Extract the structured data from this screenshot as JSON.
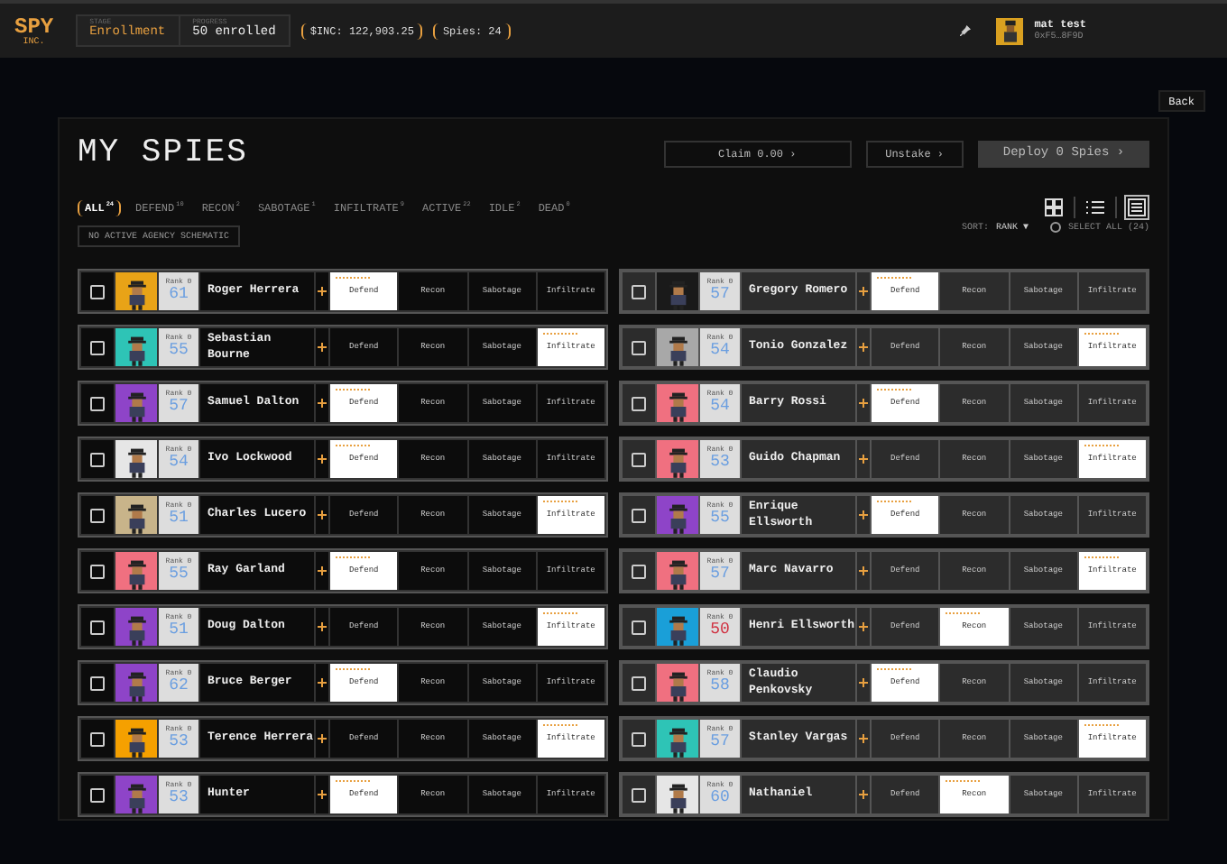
{
  "topbar": {
    "logo": "SPY",
    "logo_sub": "INC.",
    "stage_label": "STAGE",
    "stage": "Enrollment",
    "progress_label": "PROGRESS",
    "progress": "50 enrolled",
    "balance": "$INC: 122,903.25",
    "spies": "Spies: 24",
    "user_name": "mat test",
    "user_address": "0xF5…8F9D"
  },
  "back": "Back",
  "title": "MY SPIES",
  "actions": [
    {
      "label": "Claim 0.00 ›",
      "kind": "outline"
    },
    {
      "label": "Unstake ›",
      "kind": "outline"
    },
    {
      "label": "Deploy 0 Spies ›",
      "kind": "filled"
    }
  ],
  "filters": [
    {
      "label": "ALL",
      "count": "24",
      "selected": true
    },
    {
      "label": "DEFEND",
      "count": "10",
      "selected": false
    },
    {
      "label": "RECON",
      "count": "2",
      "selected": false
    },
    {
      "label": "SABOTAGE",
      "count": "1",
      "selected": false
    },
    {
      "label": "INFILTRATE",
      "count": "9",
      "selected": false
    },
    {
      "label": "ACTIVE",
      "count": "22",
      "selected": false
    },
    {
      "label": "IDLE",
      "count": "2",
      "selected": false
    },
    {
      "label": "DEAD",
      "count": "0",
      "selected": false
    }
  ],
  "views": [
    {
      "kind": "grid",
      "selected": false
    },
    {
      "kind": "list",
      "selected": false
    },
    {
      "kind": "table",
      "selected": true
    }
  ],
  "schematic": "NO ACTIVE AGENCY SCHEMATIC",
  "sort_label": "SORT:",
  "sort_value": "RANK ▼",
  "select_all": "SELECT ALL (24)",
  "select_all_checked": false,
  "columns": [
    {
      "kind": "dark",
      "spies": [
        {
          "name": "Roger Herrera",
          "rank_label": "Rank 0",
          "rank": "61",
          "warning": false,
          "color": "#e8a317",
          "checked": false,
          "missions": [
            {
              "label": "Defend",
              "selected": true
            },
            {
              "label": "Recon",
              "selected": false
            },
            {
              "label": "Sabotage",
              "selected": false
            },
            {
              "label": "Infiltrate",
              "selected": false
            }
          ]
        },
        {
          "name": "Sebastian Bourne",
          "rank_label": "Rank 0",
          "rank": "55",
          "warning": false,
          "color": "#2ec4b6",
          "checked": false,
          "missions": [
            {
              "label": "Defend",
              "selected": false
            },
            {
              "label": "Recon",
              "selected": false
            },
            {
              "label": "Sabotage",
              "selected": false
            },
            {
              "label": "Infiltrate",
              "selected": true
            }
          ]
        },
        {
          "name": "Samuel Dalton",
          "rank_label": "Rank 0",
          "rank": "57",
          "warning": false,
          "color": "#8e44c8",
          "checked": false,
          "missions": [
            {
              "label": "Defend",
              "selected": true
            },
            {
              "label": "Recon",
              "selected": false
            },
            {
              "label": "Sabotage",
              "selected": false
            },
            {
              "label": "Infiltrate",
              "selected": false
            }
          ]
        },
        {
          "name": "Ivo Lockwood",
          "rank_label": "Rank 0",
          "rank": "54",
          "warning": false,
          "color": "#e6e6e6",
          "checked": false,
          "missions": [
            {
              "label": "Defend",
              "selected": true
            },
            {
              "label": "Recon",
              "selected": false
            },
            {
              "label": "Sabotage",
              "selected": false
            },
            {
              "label": "Infiltrate",
              "selected": false
            }
          ]
        },
        {
          "name": "Charles Lucero",
          "rank_label": "Rank 0",
          "rank": "51",
          "warning": false,
          "color": "#c8b48a",
          "checked": false,
          "missions": [
            {
              "label": "Defend",
              "selected": false
            },
            {
              "label": "Recon",
              "selected": false
            },
            {
              "label": "Sabotage",
              "selected": false
            },
            {
              "label": "Infiltrate",
              "selected": true
            }
          ]
        },
        {
          "name": "Ray Garland",
          "rank_label": "Rank 0",
          "rank": "55",
          "warning": false,
          "color": "#f07080",
          "checked": false,
          "missions": [
            {
              "label": "Defend",
              "selected": true
            },
            {
              "label": "Recon",
              "selected": false
            },
            {
              "label": "Sabotage",
              "selected": false
            },
            {
              "label": "Infiltrate",
              "selected": false
            }
          ]
        },
        {
          "name": "Doug Dalton",
          "rank_label": "Rank 0",
          "rank": "51",
          "warning": false,
          "color": "#8e44c8",
          "checked": false,
          "missions": [
            {
              "label": "Defend",
              "selected": false
            },
            {
              "label": "Recon",
              "selected": false
            },
            {
              "label": "Sabotage",
              "selected": false
            },
            {
              "label": "Infiltrate",
              "selected": true
            }
          ]
        },
        {
          "name": "Bruce Berger",
          "rank_label": "Rank 0",
          "rank": "62",
          "warning": false,
          "color": "#8e44c8",
          "checked": false,
          "missions": [
            {
              "label": "Defend",
              "selected": true
            },
            {
              "label": "Recon",
              "selected": false
            },
            {
              "label": "Sabotage",
              "selected": false
            },
            {
              "label": "Infiltrate",
              "selected": false
            }
          ]
        },
        {
          "name": "Terence Herrera",
          "rank_label": "Rank 0",
          "rank": "53",
          "warning": false,
          "color": "#f5a000",
          "checked": false,
          "missions": [
            {
              "label": "Defend",
              "selected": false
            },
            {
              "label": "Recon",
              "selected": false
            },
            {
              "label": "Sabotage",
              "selected": false
            },
            {
              "label": "Infiltrate",
              "selected": true
            }
          ]
        },
        {
          "name": "Hunter",
          "rank_label": "Rank 0",
          "rank": "53",
          "warning": false,
          "color": "#8e44c8",
          "checked": false,
          "missions": [
            {
              "label": "Defend",
              "selected": true
            },
            {
              "label": "Recon",
              "selected": false
            },
            {
              "label": "Sabotage",
              "selected": false
            },
            {
              "label": "Infiltrate",
              "selected": false
            }
          ]
        }
      ]
    },
    {
      "kind": "grey",
      "spies": [
        {
          "name": "Gregory Romero",
          "rank_label": "Rank 0",
          "rank": "57",
          "warning": false,
          "color": "#1a1a1a",
          "checked": false,
          "missions": [
            {
              "label": "Defend",
              "selected": true
            },
            {
              "label": "Recon",
              "selected": false
            },
            {
              "label": "Sabotage",
              "selected": false
            },
            {
              "label": "Infiltrate",
              "selected": false
            }
          ]
        },
        {
          "name": "Tonio Gonzalez",
          "rank_label": "Rank 0",
          "rank": "54",
          "warning": false,
          "color": "#a8a8a8",
          "checked": false,
          "missions": [
            {
              "label": "Defend",
              "selected": false
            },
            {
              "label": "Recon",
              "selected": false
            },
            {
              "label": "Sabotage",
              "selected": false
            },
            {
              "label": "Infiltrate",
              "selected": true
            }
          ]
        },
        {
          "name": "Barry Rossi",
          "rank_label": "Rank 0",
          "rank": "54",
          "warning": false,
          "color": "#f07080",
          "checked": false,
          "missions": [
            {
              "label": "Defend",
              "selected": true
            },
            {
              "label": "Recon",
              "selected": false
            },
            {
              "label": "Sabotage",
              "selected": false
            },
            {
              "label": "Infiltrate",
              "selected": false
            }
          ]
        },
        {
          "name": "Guido Chapman",
          "rank_label": "Rank 0",
          "rank": "53",
          "warning": false,
          "color": "#f07080",
          "checked": false,
          "missions": [
            {
              "label": "Defend",
              "selected": false
            },
            {
              "label": "Recon",
              "selected": false
            },
            {
              "label": "Sabotage",
              "selected": false
            },
            {
              "label": "Infiltrate",
              "selected": true
            }
          ]
        },
        {
          "name": "Enrique Ellsworth",
          "rank_label": "Rank 0",
          "rank": "55",
          "warning": false,
          "color": "#8e44c8",
          "checked": false,
          "missions": [
            {
              "label": "Defend",
              "selected": true
            },
            {
              "label": "Recon",
              "selected": false
            },
            {
              "label": "Sabotage",
              "selected": false
            },
            {
              "label": "Infiltrate",
              "selected": false
            }
          ]
        },
        {
          "name": "Marc Navarro",
          "rank_label": "Rank 0",
          "rank": "57",
          "warning": false,
          "color": "#f07080",
          "checked": false,
          "missions": [
            {
              "label": "Defend",
              "selected": false
            },
            {
              "label": "Recon",
              "selected": false
            },
            {
              "label": "Sabotage",
              "selected": false
            },
            {
              "label": "Infiltrate",
              "selected": true
            }
          ]
        },
        {
          "name": "Henri Ellsworth",
          "rank_label": "Rank 0",
          "rank": "50",
          "warning": true,
          "color": "#1a9fd8",
          "checked": false,
          "missions": [
            {
              "label": "Defend",
              "selected": false
            },
            {
              "label": "Recon",
              "selected": true
            },
            {
              "label": "Sabotage",
              "selected": false
            },
            {
              "label": "Infiltrate",
              "selected": false
            }
          ]
        },
        {
          "name": "Claudio Penkovsky",
          "rank_label": "Rank 0",
          "rank": "58",
          "warning": false,
          "color": "#f07080",
          "checked": false,
          "missions": [
            {
              "label": "Defend",
              "selected": true
            },
            {
              "label": "Recon",
              "selected": false
            },
            {
              "label": "Sabotage",
              "selected": false
            },
            {
              "label": "Infiltrate",
              "selected": false
            }
          ]
        },
        {
          "name": "Stanley Vargas",
          "rank_label": "Rank 0",
          "rank": "57",
          "warning": false,
          "color": "#2ec4b6",
          "checked": false,
          "missions": [
            {
              "label": "Defend",
              "selected": false
            },
            {
              "label": "Recon",
              "selected": false
            },
            {
              "label": "Sabotage",
              "selected": false
            },
            {
              "label": "Infiltrate",
              "selected": true
            }
          ]
        },
        {
          "name": "Nathaniel",
          "rank_label": "Rank 0",
          "rank": "60",
          "warning": false,
          "color": "#e6e6e6",
          "checked": false,
          "missions": [
            {
              "label": "Defend",
              "selected": false
            },
            {
              "label": "Recon",
              "selected": true
            },
            {
              "label": "Sabotage",
              "selected": false
            },
            {
              "label": "Infiltrate",
              "selected": false
            }
          ]
        }
      ]
    }
  ]
}
